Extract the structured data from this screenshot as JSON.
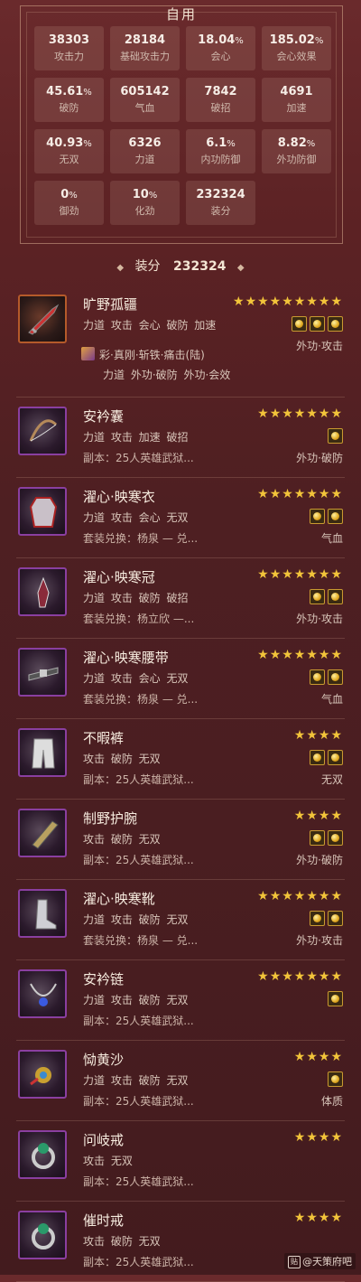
{
  "panel": {
    "title": "自用",
    "stats": [
      {
        "value": "38303",
        "unit": "",
        "label": "攻击力"
      },
      {
        "value": "28184",
        "unit": "",
        "label": "基础攻击力"
      },
      {
        "value": "18.04",
        "unit": "%",
        "label": "会心"
      },
      {
        "value": "185.02",
        "unit": "%",
        "label": "会心效果"
      },
      {
        "value": "45.61",
        "unit": "%",
        "label": "破防"
      },
      {
        "value": "605142",
        "unit": "",
        "label": "气血"
      },
      {
        "value": "7842",
        "unit": "",
        "label": "破招"
      },
      {
        "value": "4691",
        "unit": "",
        "label": "加速"
      },
      {
        "value": "40.93",
        "unit": "%",
        "label": "无双"
      },
      {
        "value": "6326",
        "unit": "",
        "label": "力道"
      },
      {
        "value": "6.1",
        "unit": "%",
        "label": "内功防御"
      },
      {
        "value": "8.82",
        "unit": "%",
        "label": "外功防御"
      },
      {
        "value": "0",
        "unit": "%",
        "label": "御劲"
      },
      {
        "value": "10",
        "unit": "%",
        "label": "化劲"
      },
      {
        "value": "232324",
        "unit": "",
        "label": "装分"
      }
    ]
  },
  "score": {
    "label": "装分",
    "value": "232324"
  },
  "equipment": [
    {
      "name": "旷野孤疆",
      "stars": "★★★★★★★★★",
      "attrs": "力道 攻击 会心 破防 加速",
      "source": "",
      "gems": 3,
      "tag": "外功·攻击",
      "enchant": {
        "name": "彩·真刚·斩铁·痛击(陆)",
        "attrs": "力道 外功·破防 外功·会效"
      },
      "icon": "blade-icon"
    },
    {
      "name": "安衿囊",
      "stars": "★★★★★★★",
      "attrs": "力道 攻击 加速 破招",
      "source": "副本：25人英雄武狱...",
      "gems": 1,
      "tag": "外功·破防",
      "icon": "bow-icon"
    },
    {
      "name": "濯心·映寒衣",
      "stars": "★★★★★★★",
      "attrs": "力道 攻击 会心 无双",
      "source": "套装兑换：杨泉 — 兑...",
      "gems": 2,
      "tag": "气血",
      "icon": "robe-icon"
    },
    {
      "name": "濯心·映寒冠",
      "stars": "★★★★★★★",
      "attrs": "力道 攻击 破防 破招",
      "source": "套装兑换：杨立欣 —...",
      "gems": 2,
      "tag": "外功·攻击",
      "icon": "hat-icon"
    },
    {
      "name": "濯心·映寒腰带",
      "stars": "★★★★★★★",
      "attrs": "力道 攻击 会心 无双",
      "source": "套装兑换：杨泉 — 兑...",
      "gems": 2,
      "tag": "气血",
      "icon": "belt-icon"
    },
    {
      "name": "不暇裤",
      "stars": "★★★★",
      "attrs": "攻击 破防 无双",
      "source": "副本：25人英雄武狱...",
      "gems": 2,
      "tag": "无双",
      "icon": "pants-icon"
    },
    {
      "name": "制野护腕",
      "stars": "★★★★",
      "attrs": "攻击 破防 无双",
      "source": "副本：25人英雄武狱...",
      "gems": 2,
      "tag": "外功·破防",
      "icon": "bracer-icon"
    },
    {
      "name": "濯心·映寒靴",
      "stars": "★★★★★★★",
      "attrs": "力道 攻击 破防 无双",
      "source": "套装兑换：杨泉 — 兑...",
      "gems": 2,
      "tag": "外功·攻击",
      "icon": "boots-icon"
    },
    {
      "name": "安衿链",
      "stars": "★★★★★★★",
      "attrs": "力道 攻击 破防 无双",
      "source": "副本：25人英雄武狱...",
      "gems": 1,
      "tag": "",
      "icon": "necklace-icon"
    },
    {
      "name": "恸黄沙",
      "stars": "★★★★",
      "attrs": "力道 攻击 破防 无双",
      "source": "副本：25人英雄武狱...",
      "gems": 1,
      "tag": "体质",
      "icon": "pendant-icon"
    },
    {
      "name": "问岐戒",
      "stars": "★★★★",
      "attrs": "攻击 无双",
      "source": "副本：25人英雄武狱...",
      "gems": 0,
      "tag": "",
      "icon": "ring-icon"
    },
    {
      "name": "催时戒",
      "stars": "★★★★",
      "attrs": "攻击 破防 无双",
      "source": "副本：25人英雄武狱...",
      "gems": 0,
      "tag": "",
      "icon": "ring-icon"
    }
  ],
  "watermark": "@天策府吧",
  "colors": {
    "star": "#f2c43a",
    "frame_purple": "#8a3fa0",
    "frame_orange": "#b55a2a"
  }
}
